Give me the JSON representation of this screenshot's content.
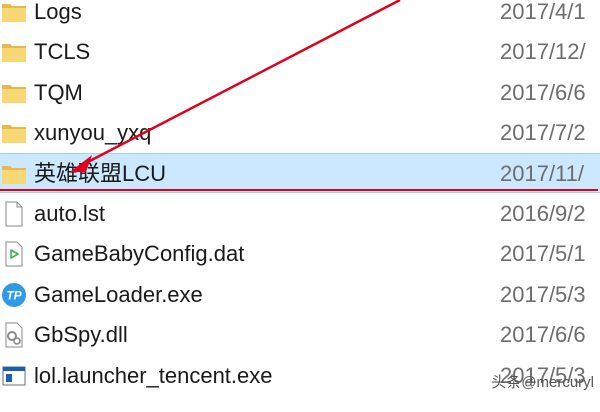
{
  "file_list": {
    "rows": [
      {
        "name": "Logs",
        "date": "2017/4/1",
        "icon": "folder-icon",
        "selected": false
      },
      {
        "name": "TCLS",
        "date": "2017/12/",
        "icon": "folder-icon",
        "selected": false
      },
      {
        "name": "TQM",
        "date": "2017/6/6",
        "icon": "folder-icon",
        "selected": false
      },
      {
        "name": "xunyou_yxq",
        "date": "2017/7/2",
        "icon": "folder-icon",
        "selected": false
      },
      {
        "name": "英雄联盟LCU",
        "date": "2017/11/",
        "icon": "folder-icon",
        "selected": true
      },
      {
        "name": "auto.lst",
        "date": "2016/9/2",
        "icon": "blank-file-icon",
        "selected": false
      },
      {
        "name": "GameBabyConfig.dat",
        "date": "2017/5/1",
        "icon": "media-file-icon",
        "selected": false
      },
      {
        "name": "GameLoader.exe",
        "date": "2017/5/3",
        "icon": "tp-app-icon",
        "selected": false
      },
      {
        "name": "GbSpy.dll",
        "date": "2017/6/6",
        "icon": "dll-file-icon",
        "selected": false
      },
      {
        "name": "lol.launcher_tencent.exe",
        "date": "2017/5/3",
        "icon": "exe-window-icon",
        "selected": false
      }
    ]
  },
  "annotation": {
    "arrow_color": "#e0001b",
    "highlight_color": "#e0001b"
  },
  "watermark": {
    "text": "头条@mercuryl"
  },
  "colors": {
    "folder": "#f8d775",
    "folder_dark": "#e8b84a",
    "selection_bg": "#cce8ff",
    "selection_border": "#99d1ff",
    "media_green": "#3cb54a",
    "tp_blue": "#2e9be6",
    "exe_blue": "#1a5fb4"
  }
}
